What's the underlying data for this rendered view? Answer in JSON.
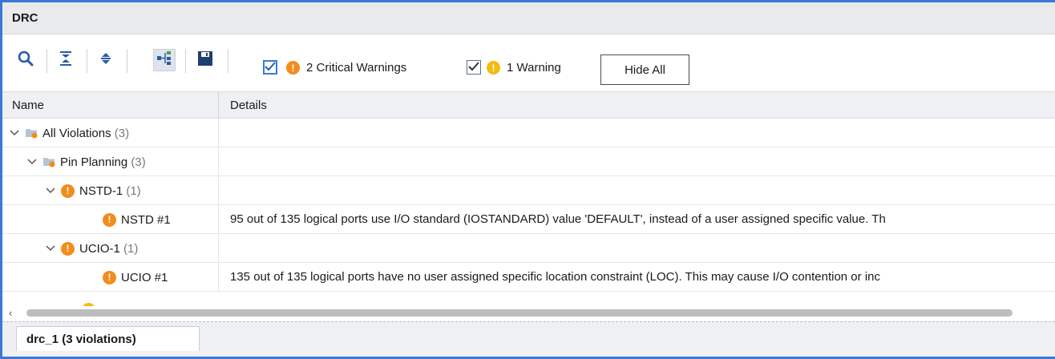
{
  "window": {
    "title": "DRC"
  },
  "toolbar": {
    "icons": [
      "search-icon",
      "collapse-all-icon",
      "expand-all-icon",
      "group-by-hierarchy-icon",
      "save-icon"
    ],
    "filters": [
      {
        "label": "2 Critical Warnings",
        "checked": true,
        "severity": "critical-warning"
      },
      {
        "label": "1 Warning",
        "checked": true,
        "severity": "warning"
      }
    ],
    "hide_all_label": "Hide All"
  },
  "columns": {
    "name": "Name",
    "details": "Details"
  },
  "tree": [
    {
      "label": "All Violations",
      "count": "(3)",
      "icon": "folder-icon",
      "expanded": true,
      "details": ""
    },
    {
      "label": "Pin Planning",
      "count": "(3)",
      "icon": "folder-icon",
      "expanded": true,
      "details": ""
    },
    {
      "label": "NSTD-1",
      "count": "(1)",
      "icon": "critical-warning-icon",
      "expanded": true,
      "details": ""
    },
    {
      "label": "NSTD #1",
      "count": "",
      "icon": "critical-warning-icon",
      "details": "95 out of 135 logical ports use I/O standard (IOSTANDARD) value 'DEFAULT', instead of a user assigned specific value. Th"
    },
    {
      "label": "UCIO-1",
      "count": "(1)",
      "icon": "critical-warning-icon",
      "expanded": true,
      "details": ""
    },
    {
      "label": "UCIO #1",
      "count": "",
      "icon": "critical-warning-icon",
      "details": "135 out of 135 logical ports have no user assigned specific location constraint (LOC). This may cause I/O contention or inc"
    }
  ],
  "bottom_tab": {
    "label": "drc_1 (3 violations)"
  },
  "colors": {
    "accent": "#3c78d8",
    "critical": "#f28c1c",
    "warning": "#f5bb14"
  }
}
